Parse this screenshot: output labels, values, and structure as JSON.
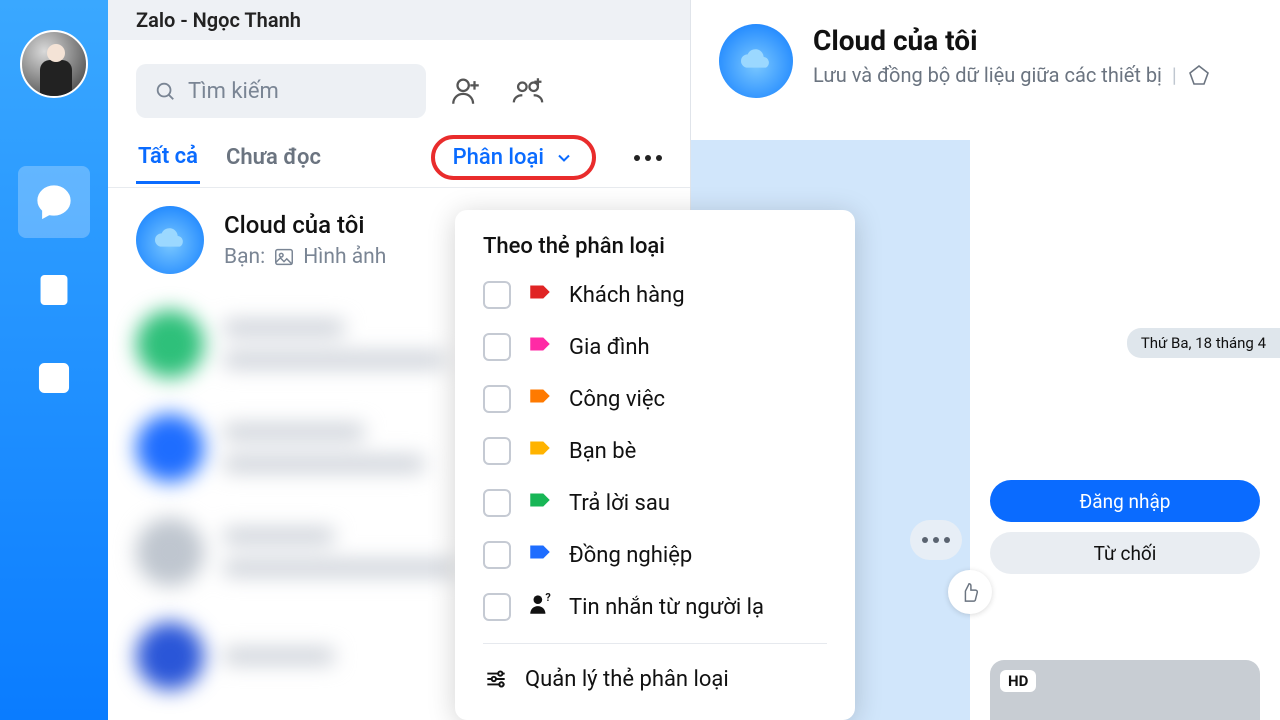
{
  "titlebar": "Zalo - Ngọc Thanh",
  "search": {
    "placeholder": "Tìm kiếm"
  },
  "tabs": {
    "all": "Tất cả",
    "unread": "Chưa đọc"
  },
  "classify_btn": "Phân loại",
  "conversations": {
    "cloud": {
      "name": "Cloud của tôi",
      "prefix": "Bạn:",
      "preview": "Hình ảnh"
    }
  },
  "popup": {
    "header": "Theo thẻ phân loại",
    "items": [
      {
        "label": "Khách hàng",
        "color": "#e02424"
      },
      {
        "label": "Gia đình",
        "color": "#ff2aa5"
      },
      {
        "label": "Công việc",
        "color": "#ff7a00"
      },
      {
        "label": "Bạn bè",
        "color": "#ffb300"
      },
      {
        "label": "Trả lời sau",
        "color": "#18b656"
      },
      {
        "label": "Đồng nghiệp",
        "color": "#1e6dff"
      }
    ],
    "stranger": "Tin nhắn từ người lạ",
    "manage": "Quản lý thẻ phân loại"
  },
  "chat": {
    "title": "Cloud của tôi",
    "subtitle": "Lưu và đồng bộ dữ liệu giữa các thiết bị",
    "login_btn": "Đăng nhập",
    "decline_btn": "Từ chối",
    "hd": "HD",
    "date": "Thứ Ba, 18 tháng 4"
  }
}
